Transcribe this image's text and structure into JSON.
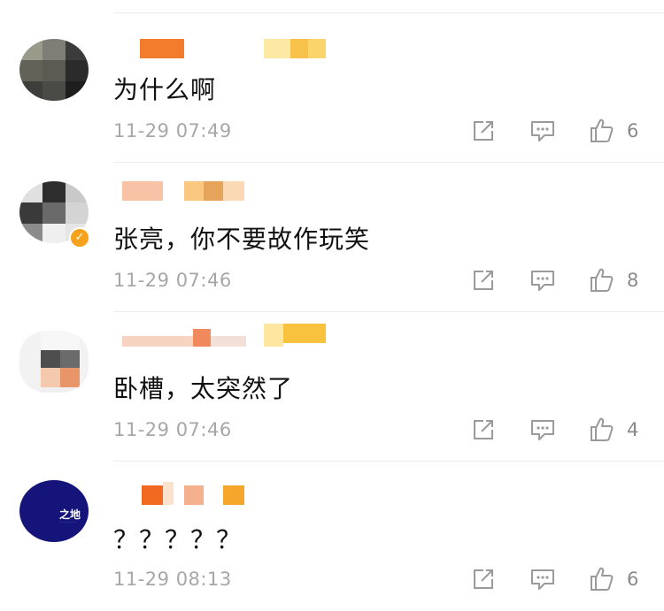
{
  "comments": [
    {
      "text": "为什么啊",
      "time": "11-29 07:49",
      "likes": "6"
    },
    {
      "text": "张亮，你不要故作玩笑",
      "time": "11-29 07:46",
      "likes": "8"
    },
    {
      "text": "卧槽，太突然了",
      "time": "11-29 07:46",
      "likes": "4"
    },
    {
      "text": "？？？？？",
      "time": "11-29 08:13",
      "likes": "6",
      "avatar_brand": "之地"
    }
  ],
  "icons": {
    "share": "share-icon",
    "comment": "comment-icon",
    "like": "thumbs-up-icon"
  },
  "colors": {
    "time": "#a7a7a7",
    "count": "#8a8a8a",
    "verify_badge": "#f6a21c",
    "brand_avatar": "#14147a"
  }
}
